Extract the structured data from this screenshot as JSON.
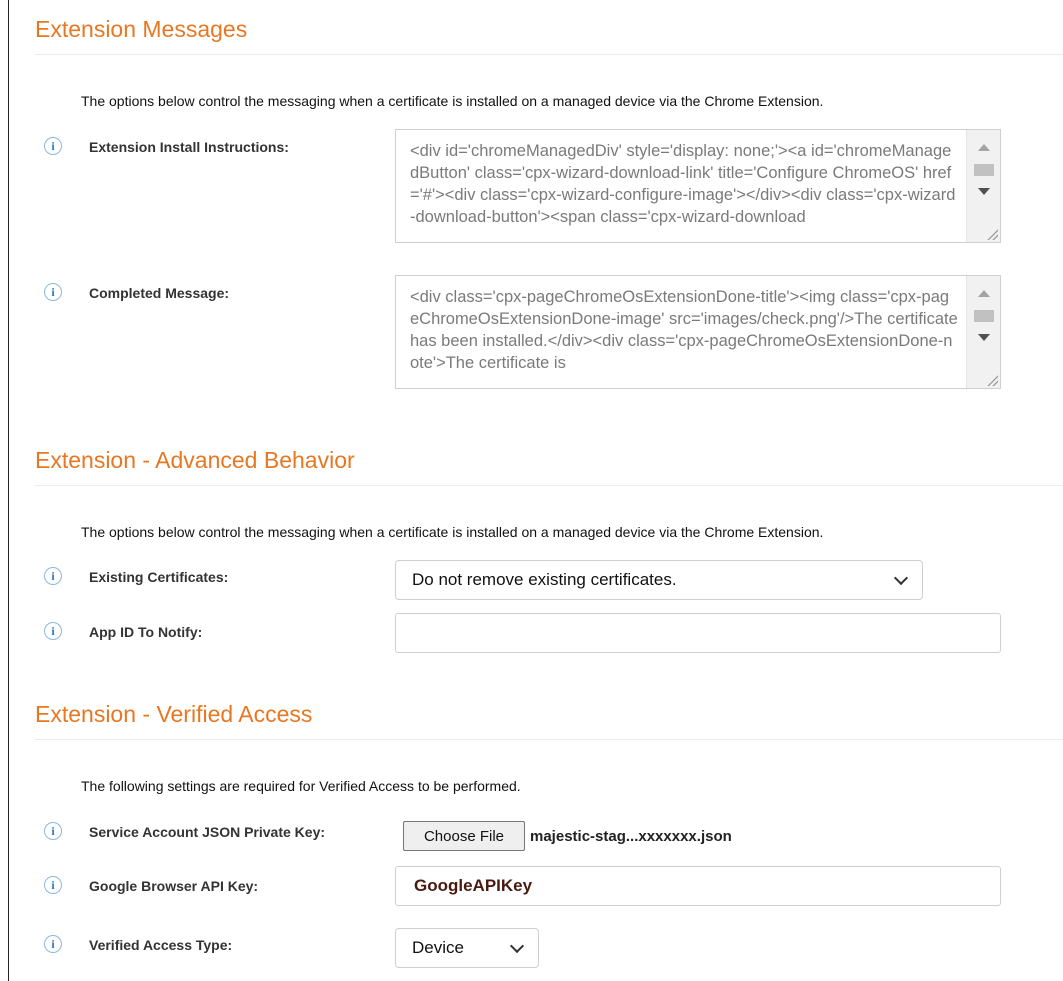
{
  "sections": {
    "messages": {
      "title": "Extension Messages",
      "description": "The options below control the messaging when a certificate is installed on a managed device via the Chrome Extension.",
      "install_instructions": {
        "label": "Extension Install Instructions:",
        "value": "<div id='chromeManagedDiv' style='display: none;'><a id='chromeManagedButton' class='cpx-wizard-download-link' title='Configure ChromeOS' href='#'><div class='cpx-wizard-configure-image'></div><div class='cpx-wizard-download-button'><span class='cpx-wizard-download"
      },
      "completed_message": {
        "label": "Completed Message:",
        "value": "<div class='cpx-pageChromeOsExtensionDone-title'><img class='cpx-pageChromeOsExtensionDone-image' src='images/check.png'/>The certificate has been installed.</div><div class='cpx-pageChromeOsExtensionDone-note'>The certificate is"
      }
    },
    "advanced": {
      "title": "Extension - Advanced Behavior",
      "description": "The options below control the messaging when a certificate is installed on a managed device via the Chrome Extension.",
      "existing_certificates": {
        "label": "Existing Certificates:",
        "value": "Do not remove existing certificates."
      },
      "app_id": {
        "label": "App ID To Notify:",
        "value": ""
      }
    },
    "verified": {
      "title": "Extension - Verified Access",
      "description": "The following settings are required for Verified Access to be performed.",
      "private_key": {
        "label": "Service Account JSON Private Key:",
        "button_label": "Choose File",
        "file_name": "majestic-stag...xxxxxxx.json"
      },
      "api_key": {
        "label": "Google Browser API Key:",
        "value": "GoogleAPIKey"
      },
      "access_type": {
        "label": "Verified Access Type:",
        "value": "Device"
      }
    }
  },
  "icons": {
    "info_glyph": "i",
    "info_icon_name": "info-icon"
  },
  "colors": {
    "section_title": "#e87722",
    "info_icon": "#2a7ac8",
    "input_value": "#4a1a10"
  }
}
